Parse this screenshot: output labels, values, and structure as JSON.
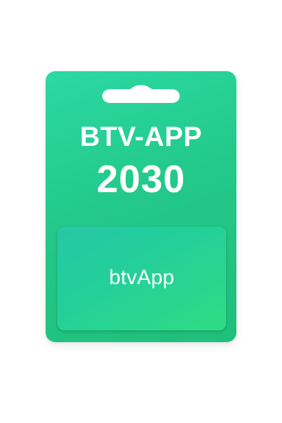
{
  "product": {
    "title_line_1": "BTV-APP",
    "title_line_2": "2030"
  },
  "inner_card": {
    "logo_text": "btvApp"
  },
  "colors": {
    "card_green": "#23c98b",
    "inner_card_green": "#24cf9a",
    "text": "#ffffff",
    "background": "#ffffff"
  },
  "icons": {
    "hang_slot": "hang-slot-icon"
  }
}
